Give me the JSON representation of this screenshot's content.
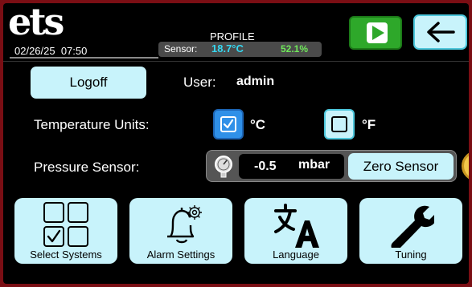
{
  "header": {
    "logo": "ets",
    "datetime": "02/26/25  07:50",
    "profile_label": "PROFILE",
    "sensor_label": "Sensor:",
    "sensor_temp": "18.7°C",
    "sensor_humidity": "52.1%"
  },
  "controls": {
    "play_icon": "play-icon",
    "back_icon": "back-arrow-icon"
  },
  "user_row": {
    "logoff_label": "Logoff",
    "user_label": "User:",
    "user_name": "admin"
  },
  "temperature_units": {
    "label": "Temperature Units:",
    "celsius_label": "°C",
    "fahrenheit_label": "°F",
    "celsius_checked": true,
    "fahrenheit_checked": false
  },
  "pressure": {
    "label": "Pressure Sensor:",
    "value": "-0.5",
    "unit": "mbar",
    "zero_label": "Zero Sensor",
    "gauge_icon": "gauge-icon"
  },
  "tiles": [
    {
      "label": "Select Systems",
      "icon": "select-systems-icon"
    },
    {
      "label": "Alarm Settings",
      "icon": "alarm-bell-icon"
    },
    {
      "label": "Language",
      "icon": "language-icon"
    },
    {
      "label": "Tuning",
      "icon": "wrench-icon"
    }
  ],
  "colors": {
    "border": "#7a0e14",
    "accent_cyan": "#c8f3fb",
    "play_green": "#2ea82a",
    "checked_blue": "#2f90e8",
    "temp_text": "#35d7f0",
    "humidity_text": "#6fe85a"
  }
}
